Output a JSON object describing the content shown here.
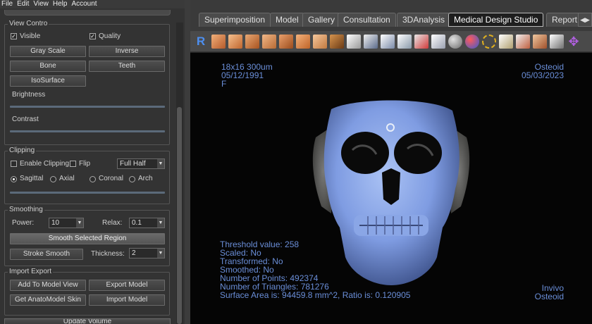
{
  "menubar": {
    "items": [
      "File",
      "Edit",
      "View",
      "Help",
      "Account"
    ]
  },
  "view_control": {
    "title": "View Contro",
    "visible_label": "Visible",
    "quality_label": "Quality",
    "gray_scale": "Gray Scale",
    "inverse": "Inverse",
    "bone": "Bone",
    "teeth": "Teeth",
    "isosurface": "IsoSurface",
    "brightness_label": "Brightness",
    "contrast_label": "Contrast"
  },
  "clipping": {
    "title": "Clipping",
    "enable_label": "Enable Clipping",
    "flip_label": "Flip",
    "mode_value": "Full Half",
    "sagittal": "Sagittal",
    "axial": "Axial",
    "coronal": "Coronal",
    "arch": "Arch"
  },
  "smoothing": {
    "title": "Smoothing",
    "power_label": "Power:",
    "power_value": "10",
    "relax_label": "Relax:",
    "relax_value": "0.1",
    "smooth_selected": "Smooth Selected Region",
    "stroke_smooth": "Stroke Smooth",
    "thickness_label": "Thickness:",
    "thickness_value": "2"
  },
  "import_export": {
    "title": "Import Export",
    "add_to_model_view": "Add To Model View",
    "export_model": "Export Model",
    "get_skin": "Get AnatoModel Skin",
    "import_model": "Import Model",
    "update_volume": "Update Volume"
  },
  "tabs": [
    "Superimposition",
    "Model",
    "Gallery",
    "Consultation",
    "3DAnalysis",
    "Medical Design Studio",
    "Report"
  ],
  "active_tab": "Medical Design Studio",
  "toolbar": {
    "first_label": "R"
  },
  "viewport": {
    "top_left": [
      "18x16 300um",
      "05/12/1991",
      "F"
    ],
    "top_right": [
      "Osteoid",
      "05/03/2023"
    ],
    "stats": [
      "Threshold value: 258",
      "Scaled: No",
      "Transformed: No",
      "Smoothed: No",
      "Number of Points: 492374",
      "Number of Triangles: 781276",
      "Surface Area is: 94459.8 mm^2, Ratio is: 0.120905"
    ],
    "bottom_right": [
      "Invivo",
      "Osteoid"
    ]
  },
  "colors": {
    "overlay_text": "#6a8ed8",
    "accent": "#4d8ff0",
    "bone": "#8aa6e6"
  }
}
